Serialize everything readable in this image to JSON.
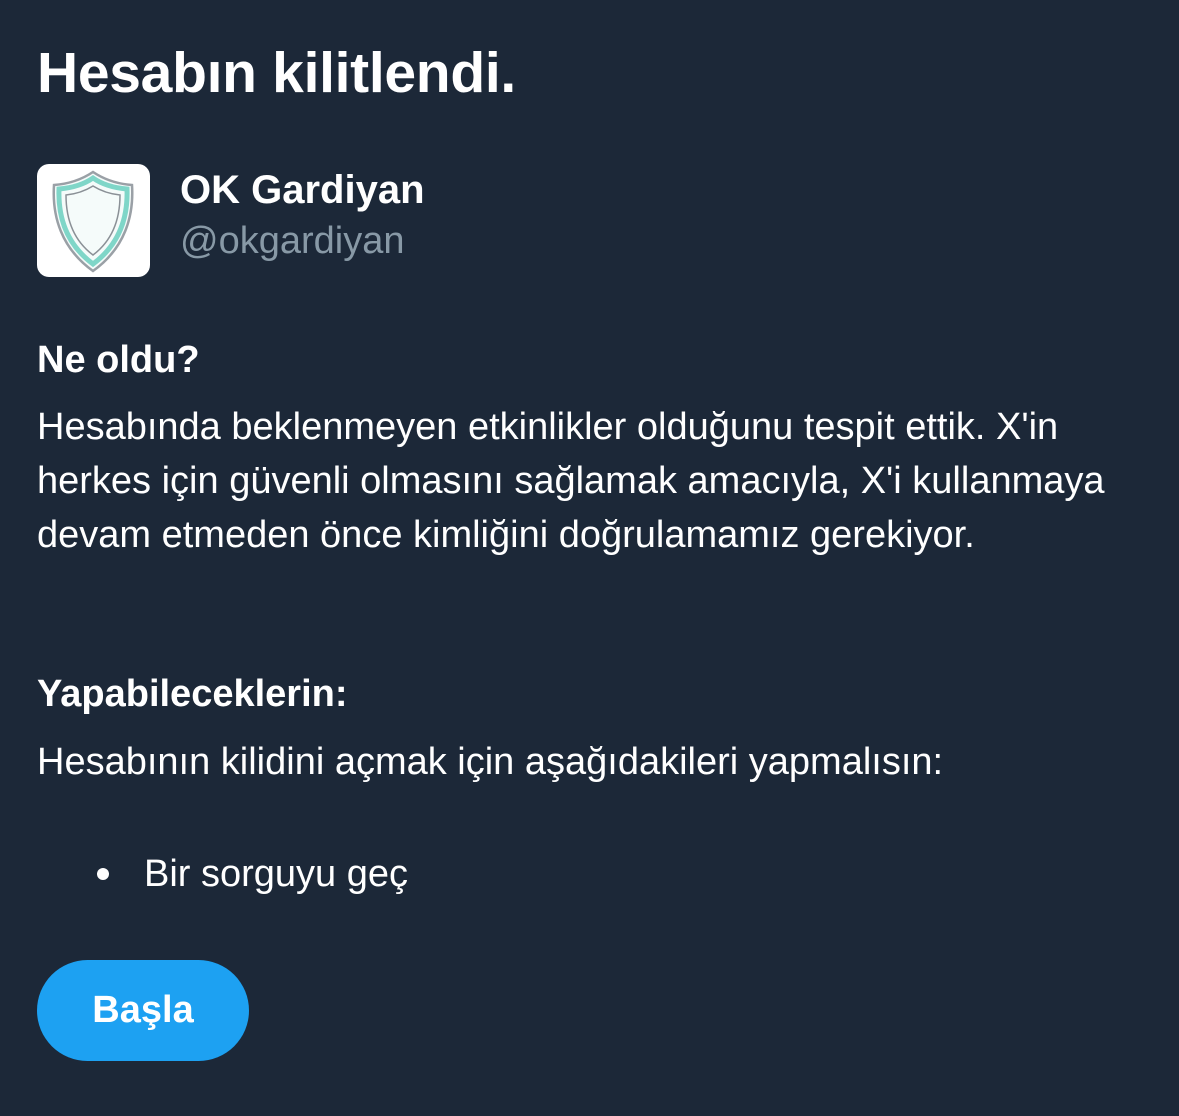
{
  "page": {
    "title": "Hesabın kilitlendi."
  },
  "account": {
    "avatar_icon": "shield-icon",
    "name": "OK Gardiyan",
    "handle": "@okgardiyan"
  },
  "what_happened": {
    "heading": "Ne oldu?",
    "body": "Hesabında beklenmeyen etkinlikler olduğunu tespit ettik. X'in herkes için güvenli olmasını sağlamak amacıyla, X'i kullanmaya devam etmeden önce kimliğini doğrulamamız gerekiyor."
  },
  "what_you_can_do": {
    "heading": "Yapabileceklerin:",
    "body": "Hesabının kilidini açmak için aşağıdakileri yapmalısın:",
    "steps": [
      {
        "label": "Bir sorguyu geç"
      }
    ]
  },
  "actions": {
    "start_label": "Başla"
  },
  "colors": {
    "background": "#1c2838",
    "text": "#ffffff",
    "muted_text": "#8899a6",
    "button": "#1da1f2"
  }
}
